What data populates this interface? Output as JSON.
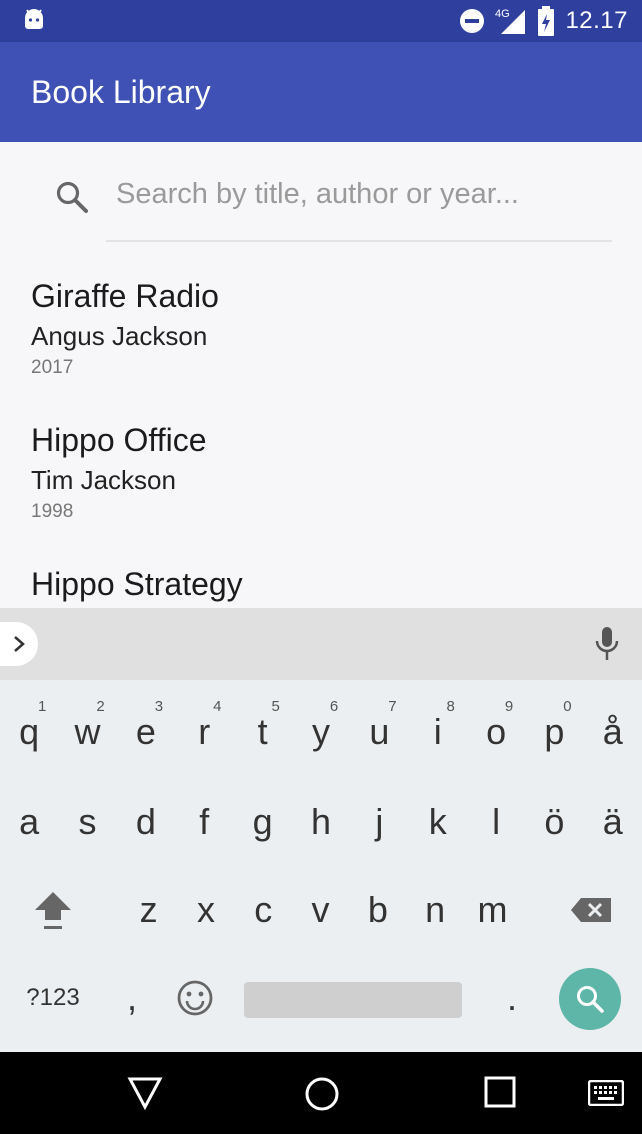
{
  "status_bar": {
    "time": "12.17",
    "network": "4G",
    "icons": [
      "android-icon",
      "do-not-disturb-icon",
      "signal-icon",
      "battery-icon"
    ]
  },
  "app_bar": {
    "title": "Book Library"
  },
  "search": {
    "placeholder": "Search by title, author or year...",
    "value": ""
  },
  "books": [
    {
      "title": "Giraffe Radio",
      "author": "Angus Jackson",
      "year": "2017"
    },
    {
      "title": "Hippo Office",
      "author": "Tim Jackson",
      "year": "1998"
    },
    {
      "title": "Hippo Strategy",
      "author": "",
      "year": ""
    }
  ],
  "keyboard": {
    "row1": [
      {
        "k": "q",
        "n": "1"
      },
      {
        "k": "w",
        "n": "2"
      },
      {
        "k": "e",
        "n": "3"
      },
      {
        "k": "r",
        "n": "4"
      },
      {
        "k": "t",
        "n": "5"
      },
      {
        "k": "y",
        "n": "6"
      },
      {
        "k": "u",
        "n": "7"
      },
      {
        "k": "i",
        "n": "8"
      },
      {
        "k": "o",
        "n": "9"
      },
      {
        "k": "p",
        "n": "0"
      },
      {
        "k": "å",
        "n": ""
      }
    ],
    "row2": [
      "a",
      "s",
      "d",
      "f",
      "g",
      "h",
      "j",
      "k",
      "l",
      "ö",
      "ä"
    ],
    "row3": [
      "z",
      "x",
      "c",
      "v",
      "b",
      "n",
      "m"
    ],
    "symbols_label": "?123",
    "comma": ",",
    "period": ".",
    "accent_color": "#5db6a8"
  },
  "colors": {
    "status_bar": "#2f3f9e",
    "app_bar": "#3f51b5"
  }
}
